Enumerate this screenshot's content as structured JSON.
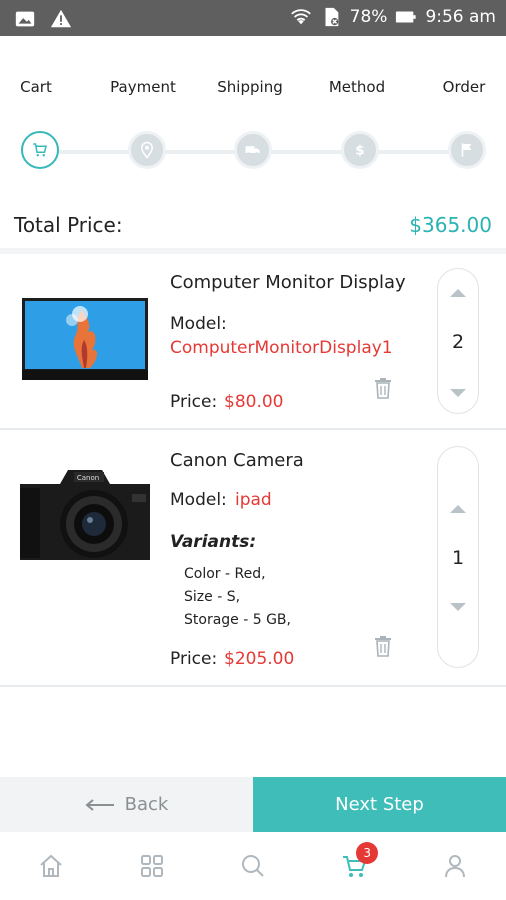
{
  "status_bar": {
    "battery": "78%",
    "time": "9:56 am",
    "icons": [
      "image-icon",
      "warning-icon",
      "wifi-icon",
      "sim-icon",
      "battery-icon"
    ]
  },
  "steps": [
    {
      "label": "Cart",
      "icon": "cart-icon",
      "active": true
    },
    {
      "label": "Payment",
      "icon": "location-pin-icon",
      "active": false
    },
    {
      "label": "Shipping",
      "icon": "truck-icon",
      "active": false
    },
    {
      "label": "Method",
      "icon": "dollar-icon",
      "active": false
    },
    {
      "label": "Order",
      "icon": "flag-icon",
      "active": false
    }
  ],
  "total": {
    "label": "Total Price:",
    "value": "$365.00"
  },
  "items": [
    {
      "name": "Computer Monitor Display",
      "model_label": "Model:",
      "model_value": "ComputerMonitorDisplay1",
      "price_label": "Price:",
      "price_value": "$80.00",
      "quantity": "2"
    },
    {
      "name": "Canon Camera",
      "model_label": "Model:",
      "model_value": "ipad",
      "variants_label": "Variants:",
      "variants": [
        "Color - Red,",
        "Size - S,",
        "Storage - 5 GB,"
      ],
      "price_label": "Price:",
      "price_value": "$205.00",
      "quantity": "1"
    }
  ],
  "actions": {
    "back_label": "Back",
    "next_label": "Next Step"
  },
  "bottom_nav": {
    "items": [
      "home-icon",
      "grid-icon",
      "search-icon",
      "cart-icon",
      "profile-icon"
    ],
    "cart_badge": "3",
    "active": "cart-icon"
  },
  "colors": {
    "accent": "#3fbdb9",
    "price_red": "#e53935",
    "status_bar": "#5f5f5f"
  }
}
